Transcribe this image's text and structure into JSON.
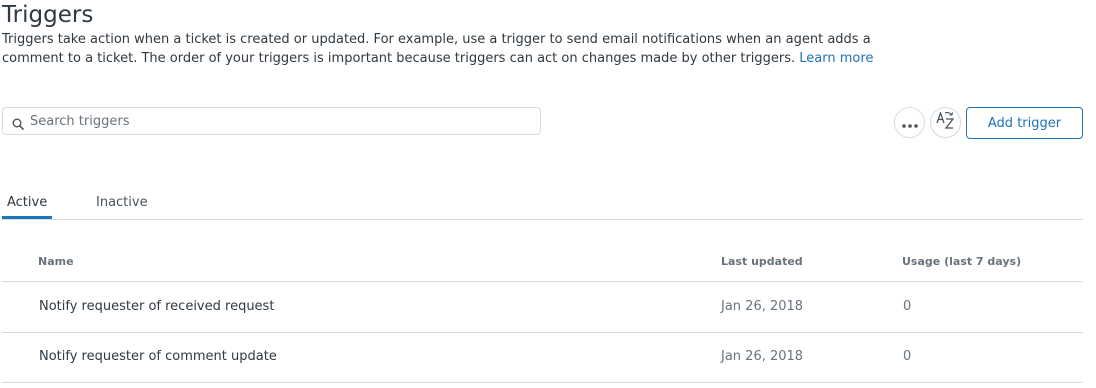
{
  "header": {
    "title": "Triggers",
    "description": "Triggers take action when a ticket is created or updated. For example, use a trigger to send email notifications when an agent adds a comment to a ticket. The order of your triggers is important because triggers can act on changes made by other triggers.",
    "learn_more": "Learn more"
  },
  "toolbar": {
    "search_placeholder": "Search triggers",
    "more_icon": "ellipsis-icon",
    "sort_icon": "sort-az-icon",
    "add_label": "Add trigger"
  },
  "tabs": [
    {
      "label": "Active",
      "selected": true
    },
    {
      "label": "Inactive",
      "selected": false
    }
  ],
  "table": {
    "columns": [
      "Name",
      "Last updated",
      "Usage (last 7 days)"
    ],
    "rows": [
      {
        "name": "Notify requester of received request",
        "updated": "Jan 26, 2018",
        "usage": "0"
      },
      {
        "name": "Notify requester of comment update",
        "updated": "Jan 26, 2018",
        "usage": "0"
      }
    ]
  },
  "colors": {
    "accent": "#1f73b7",
    "text": "#2f3941",
    "muted": "#68737d",
    "border": "#d8dcde"
  }
}
